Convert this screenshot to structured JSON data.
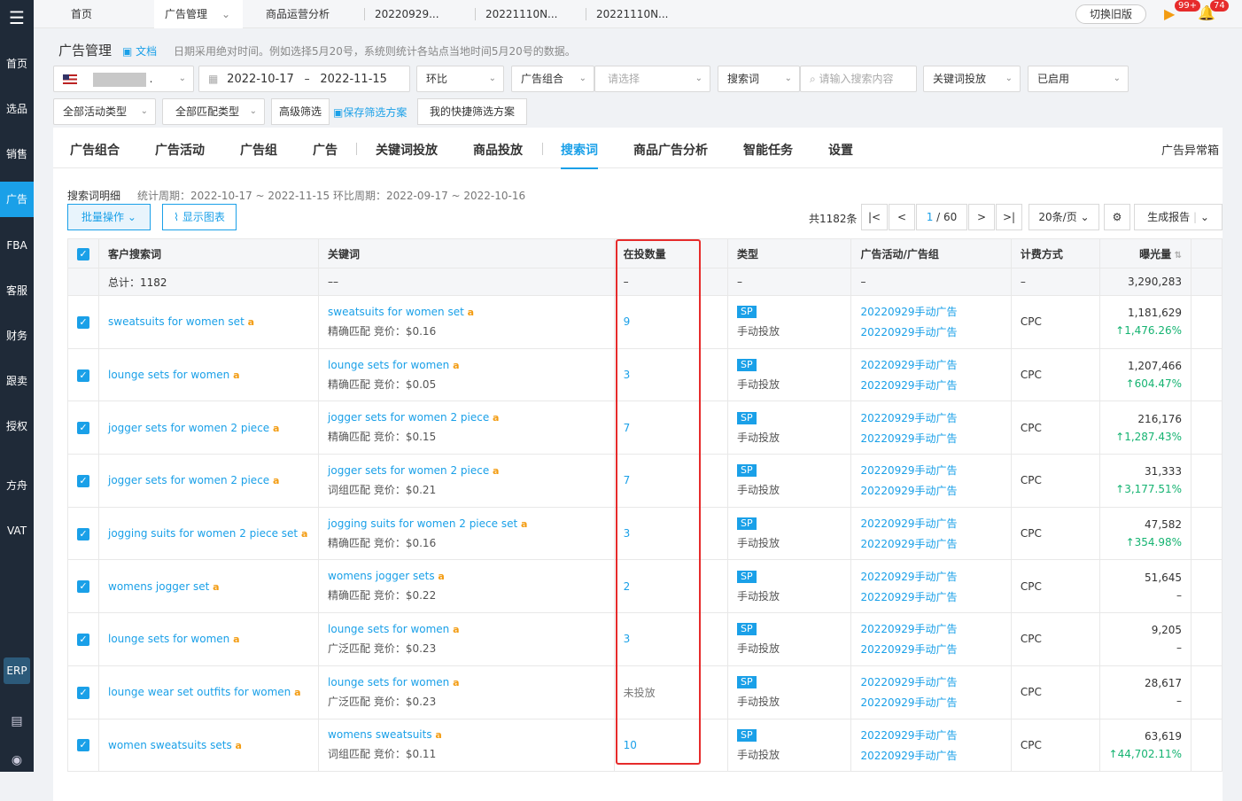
{
  "sidebar": {
    "logo": "logo-icon",
    "items": [
      {
        "label": "首页"
      },
      {
        "label": "选品"
      },
      {
        "label": "销售"
      },
      {
        "label": "广告"
      },
      {
        "label": "FBA"
      },
      {
        "label": "客服"
      },
      {
        "label": "财务"
      },
      {
        "label": "跟卖"
      },
      {
        "label": "授权"
      },
      {
        "label": "方舟"
      },
      {
        "label": "VAT"
      }
    ],
    "erp": "ERP"
  },
  "tabs": [
    {
      "label": "首页"
    },
    {
      "label": "广告管理"
    },
    {
      "label": "商品运营分析"
    },
    {
      "label": "20220929..."
    },
    {
      "label": "20221110N..."
    },
    {
      "label": "20221110N..."
    }
  ],
  "topbar": {
    "switch_label": "切换旧版",
    "badge_1": "99+",
    "badge_2": "74"
  },
  "header": {
    "title": "广告管理",
    "doc_label": "文档",
    "notice": "日期采用绝对时间。例如选择5月20号，系统则统计各站点当地时间5月20号的数据。"
  },
  "filters": {
    "store_suffix": ".",
    "date_start": "2022-10-17",
    "date_sep": "–",
    "date_end": "2022-11-15",
    "compare": "环比",
    "ad_group": "广告组合",
    "ad_group_placeholder": "请选择",
    "search_type": "搜索词",
    "search_placeholder": "请输入搜索内容",
    "keyword_targeting": "关键词投放",
    "status": "已启用",
    "activity_type": "全部活动类型",
    "match_type": "全部匹配类型",
    "advanced": "高级筛选",
    "save_scheme": "保存筛选方案",
    "my_scheme": "我的快捷筛选方案"
  },
  "subnav": {
    "items": [
      {
        "label": "广告组合"
      },
      {
        "label": "广告活动"
      },
      {
        "label": "广告组"
      },
      {
        "label": "广告"
      },
      {
        "label": "关键词投放"
      },
      {
        "label": "商品投放"
      },
      {
        "label": "搜索词"
      },
      {
        "label": "商品广告分析"
      },
      {
        "label": "智能任务"
      },
      {
        "label": "设置"
      }
    ],
    "right_link": "广告异常箱"
  },
  "section": {
    "title": "搜索词明细",
    "period": "统计周期：2022-10-17 ~ 2022-11-15 环比周期：2022-09-17 ~ 2022-10-16",
    "batch_label": "批量操作",
    "chart_label": "显示图表"
  },
  "pagination": {
    "total": "共1182条",
    "current": "1",
    "pages": "/ 60",
    "page_size": "20条/页",
    "report": "生成报告"
  },
  "table": {
    "headers": [
      "客户搜索词",
      "关键词",
      "在投数量",
      "类型",
      "广告活动/广告组",
      "计费方式",
      "曝光量"
    ],
    "summary": {
      "label": "总计：1182",
      "keyword": "––",
      "count": "–",
      "type": "–",
      "campaign": "–",
      "billing": "–",
      "impressions": "3,290,283"
    },
    "rows": [
      {
        "term": "sweatsuits for women set",
        "keyword": "sweatsuits for women set",
        "match": "精确匹配 竞价：$0.16",
        "count": "9",
        "type_tag": "SP",
        "type": "手动投放",
        "campaign": "20220929手动广告",
        "group": "20220929手动广告",
        "billing": "CPC",
        "impressions": "1,181,629",
        "change": "↑1,476.26%"
      },
      {
        "term": "lounge sets for women",
        "keyword": "lounge sets for women",
        "match": "精确匹配 竞价：$0.05",
        "count": "3",
        "type_tag": "SP",
        "type": "手动投放",
        "campaign": "20220929手动广告",
        "group": "20220929手动广告",
        "billing": "CPC",
        "impressions": "1,207,466",
        "change": "↑604.47%"
      },
      {
        "term": "jogger sets for women 2 piece",
        "keyword": "jogger sets for women 2 piece",
        "match": "精确匹配 竞价：$0.15",
        "count": "7",
        "type_tag": "SP",
        "type": "手动投放",
        "campaign": "20220929手动广告",
        "group": "20220929手动广告",
        "billing": "CPC",
        "impressions": "216,176",
        "change": "↑1,287.43%"
      },
      {
        "term": "jogger sets for women 2 piece",
        "keyword": "jogger sets for women 2 piece",
        "match": "词组匹配 竞价：$0.21",
        "count": "7",
        "type_tag": "SP",
        "type": "手动投放",
        "campaign": "20220929手动广告",
        "group": "20220929手动广告",
        "billing": "CPC",
        "impressions": "31,333",
        "change": "↑3,177.51%"
      },
      {
        "term": "jogging suits for women 2 piece set",
        "keyword": "jogging suits for women 2 piece set",
        "match": "精确匹配 竞价：$0.16",
        "count": "3",
        "type_tag": "SP",
        "type": "手动投放",
        "campaign": "20220929手动广告",
        "group": "20220929手动广告",
        "billing": "CPC",
        "impressions": "47,582",
        "change": "↑354.98%"
      },
      {
        "term": "womens jogger set",
        "keyword": "womens jogger sets",
        "match": "精确匹配 竞价：$0.22",
        "count": "2",
        "type_tag": "SP",
        "type": "手动投放",
        "campaign": "20220929手动广告",
        "group": "20220929手动广告",
        "billing": "CPC",
        "impressions": "51,645",
        "change": "–"
      },
      {
        "term": "lounge sets for women",
        "keyword": "lounge sets for women",
        "match": "广泛匹配 竞价：$0.23",
        "count": "3",
        "type_tag": "SP",
        "type": "手动投放",
        "campaign": "20220929手动广告",
        "group": "20220929手动广告",
        "billing": "CPC",
        "impressions": "9,205",
        "change": "–"
      },
      {
        "term": "lounge wear set outfits for women",
        "keyword": "lounge sets for women",
        "match": "广泛匹配 竞价：$0.23",
        "count": "未投放",
        "type_tag": "SP",
        "type": "手动投放",
        "campaign": "20220929手动广告",
        "group": "20220929手动广告",
        "billing": "CPC",
        "impressions": "28,617",
        "change": "–"
      },
      {
        "term": "women sweatsuits sets",
        "keyword": "womens sweatsuits",
        "match": "词组匹配 竞价：$0.11",
        "count": "10",
        "type_tag": "SP",
        "type": "手动投放",
        "campaign": "20220929手动广告",
        "group": "20220929手动广告",
        "billing": "CPC",
        "impressions": "63,619",
        "change": "↑44,702.11%"
      }
    ]
  },
  "colors": {
    "accent": "#1aa0e8",
    "up": "#15b371",
    "highlight": "#e62b2b",
    "sidebar": "#1f2a38"
  }
}
